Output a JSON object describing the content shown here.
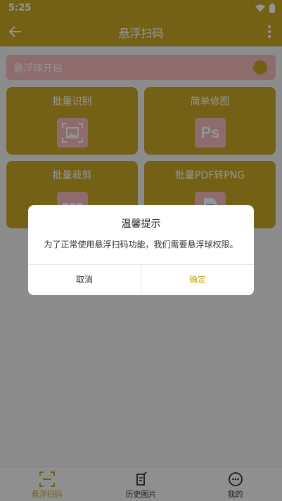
{
  "status_bar": {
    "time": "5:25"
  },
  "app_bar": {
    "title": "悬浮扫码"
  },
  "floating_toggle": {
    "label": "悬浮球开启"
  },
  "cards": [
    {
      "label": "批量识别",
      "icon": "image-scan-icon"
    },
    {
      "label": "简单修图",
      "icon": "ps-icon"
    },
    {
      "label": "批量裁剪",
      "icon": "crop-icon"
    },
    {
      "label": "批量PDF转PNG",
      "icon": "pdf-icon"
    }
  ],
  "dialog": {
    "title": "温馨提示",
    "message": "为了正常使用悬浮扫码功能，我们需要悬浮球权限。",
    "cancel_label": "取消",
    "ok_label": "确定"
  },
  "bottom_nav": {
    "items": [
      {
        "label": "悬浮扫码",
        "active": true
      },
      {
        "label": "历史图片",
        "active": false
      },
      {
        "label": "我的",
        "active": false
      }
    ]
  },
  "colors": {
    "accent": "#caa826",
    "pink": "#f4b8bc",
    "active_text": "#c8a524"
  }
}
